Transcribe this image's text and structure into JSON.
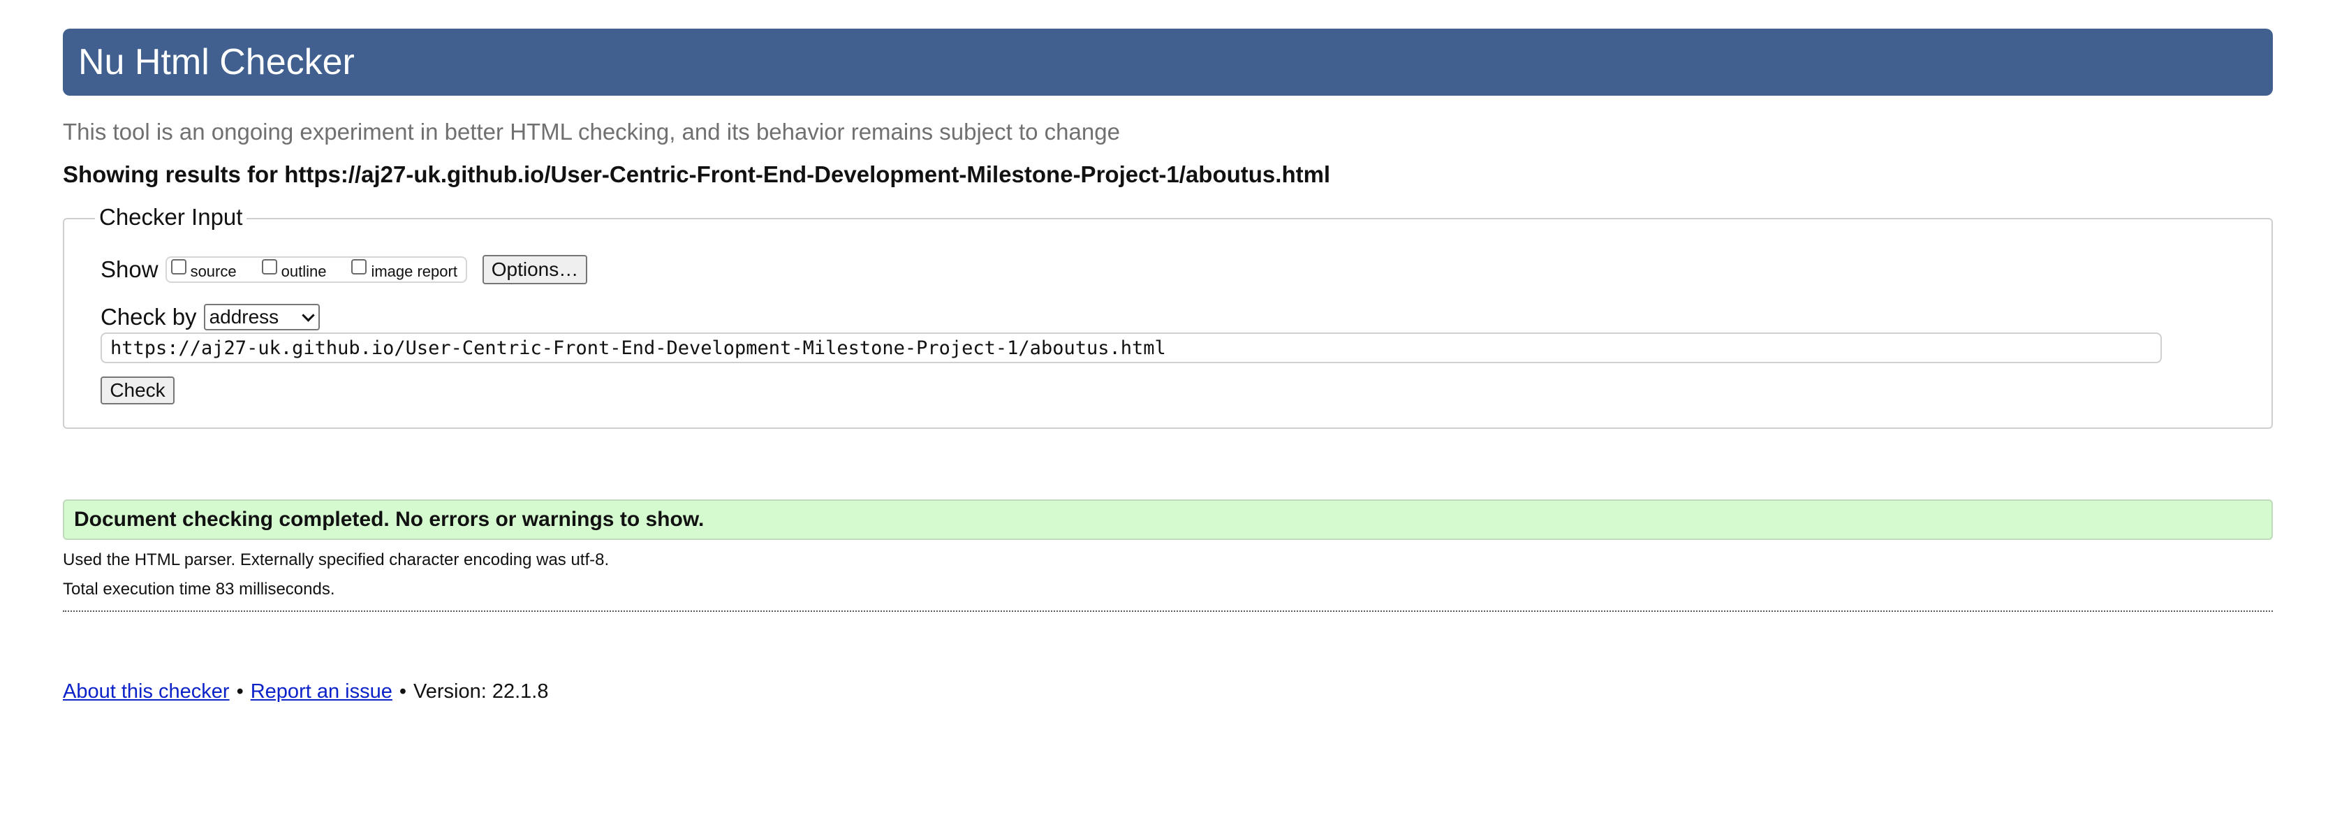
{
  "header": {
    "title": "Nu Html Checker"
  },
  "subtitle": "This tool is an ongoing experiment in better HTML checking, and its behavior remains subject to change",
  "results_for": "Showing results for https://aj27-uk.github.io/User-Centric-Front-End-Development-Milestone-Project-1/aboutus.html",
  "checker_input": {
    "legend": "Checker Input",
    "show_label": "Show",
    "show_options": [
      {
        "label": "source",
        "checked": false
      },
      {
        "label": "outline",
        "checked": false
      },
      {
        "label": "image report",
        "checked": false
      }
    ],
    "options_button": "Options…",
    "check_by_label": "Check by",
    "check_by_selected": "address",
    "url_value": "https://aj27-uk.github.io/User-Centric-Front-End-Development-Milestone-Project-1/aboutus.html",
    "check_button": "Check"
  },
  "result": {
    "message": "Document checking completed. No errors or warnings to show.",
    "parser_info": "Used the HTML parser. Externally specified character encoding was utf-8.",
    "execution_time": "Total execution time 83 milliseconds."
  },
  "footer": {
    "about_link": "About this checker",
    "separator": "•",
    "report_link": "Report an issue",
    "version": "Version: 22.1.8"
  },
  "colors": {
    "header_bg": "#41608f",
    "success_bg": "#d6fad0",
    "link": "#0b22c9"
  }
}
